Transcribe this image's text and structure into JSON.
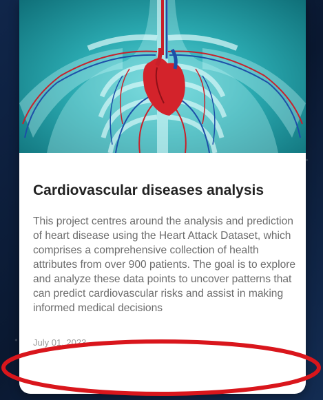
{
  "card": {
    "title": "Cardiovascular diseases analysis",
    "description": "This project centres around the analysis and prediction of heart disease using the Heart Attack Dataset, which comprises a comprehensive collection of health attributes from over 900 patients. The goal is to explore and analyze these data points to uncover patterns that can predict cardiovascular risks and assist in making informed medical decisions",
    "date": "July 01, 2023",
    "image_icon": "anatomy-heart-icon"
  },
  "colors": {
    "annotation": "#d9161c",
    "hero": "#2aa9b0",
    "title": "#222222",
    "text": "#6b6b6b"
  }
}
